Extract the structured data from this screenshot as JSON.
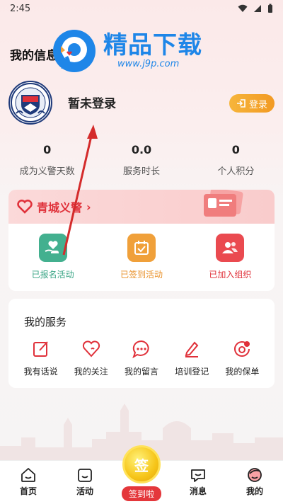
{
  "status_bar": {
    "time": "2:45"
  },
  "header": {
    "title": "我的信息"
  },
  "watermark": {
    "title": "精品下载",
    "url": "www.j9p.com"
  },
  "profile": {
    "username": "暂未登录",
    "login_label": "登录",
    "avatar_text": "青城义警"
  },
  "stats": [
    {
      "value": "0",
      "label": "成为义警天数"
    },
    {
      "value": "0.0",
      "label": "服务时长"
    },
    {
      "value": "0",
      "label": "个人积分"
    }
  ],
  "org": {
    "name": "青城义警",
    "chevron": "›",
    "actions": [
      {
        "label": "已报名活动",
        "icon": "heart-hand-icon",
        "color": "#3aa585"
      },
      {
        "label": "已签到活动",
        "icon": "calendar-check-icon",
        "color": "#e9922b"
      },
      {
        "label": "已加入组织",
        "icon": "group-icon",
        "color": "#e0313a"
      }
    ]
  },
  "services": {
    "title": "我的服务",
    "items": [
      {
        "label": "我有话说",
        "icon": "edit-icon"
      },
      {
        "label": "我的关注",
        "icon": "heart-icon"
      },
      {
        "label": "我的留言",
        "icon": "comment-icon"
      },
      {
        "label": "培训登记",
        "icon": "pen-icon"
      },
      {
        "label": "我的保单",
        "icon": "policy-icon"
      }
    ]
  },
  "nav": {
    "items": [
      {
        "label": "首页",
        "icon": "home-icon"
      },
      {
        "label": "活动",
        "icon": "activity-icon"
      },
      {
        "label": "签到啦",
        "icon": "sign-in-icon",
        "coin_text": "签"
      },
      {
        "label": "消息",
        "icon": "message-icon"
      },
      {
        "label": "我的",
        "icon": "profile-icon"
      }
    ]
  },
  "colors": {
    "accent": "#e0313a",
    "login": "#f29a23",
    "watermark": "#1e86e8"
  }
}
